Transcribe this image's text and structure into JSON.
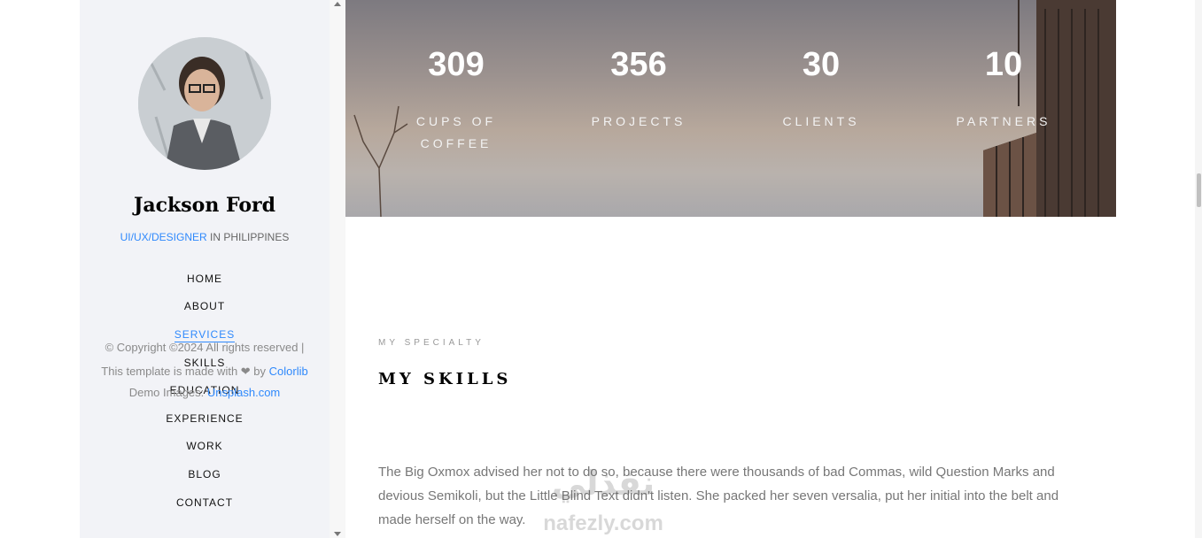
{
  "sidebar": {
    "name": "Jackson Ford",
    "role_link": "UI/UX/DESIGNER",
    "role_rest": " IN PHILIPPINES",
    "nav": [
      "HOME",
      "ABOUT",
      "SERVICES",
      "SKILLS",
      "EDUCATION",
      "EXPERIENCE",
      "WORK",
      "BLOG",
      "CONTACT"
    ],
    "active_nav": "SERVICES",
    "footer": {
      "copyright": "© Copyright ©2024 All rights reserved |",
      "made_with_prefix": "This template is made with ❤ by ",
      "made_with_link": "Colorlib",
      "demo_prefix": "Demo Images: ",
      "demo_link": "Unsplash.com"
    }
  },
  "stats": [
    {
      "number": "309",
      "label_line1": "CUPS OF",
      "label_line2": "COFFEE"
    },
    {
      "number": "356",
      "label_line1": "PROJECTS",
      "label_line2": ""
    },
    {
      "number": "30",
      "label_line1": "CLIENTS",
      "label_line2": ""
    },
    {
      "number": "10",
      "label_line1": "PARTNERS",
      "label_line2": ""
    }
  ],
  "section": {
    "subheading": "MY SPECIALTY",
    "heading": "MY SKILLS",
    "paragraph": "The Big Oxmox advised her not to do so, because there were thousands of bad Commas, wild Question Marks and devious Semikoli, but the Little Blind Text didn't listen. She packed her seven versalia, put her initial into the belt and made herself on the way."
  },
  "watermark": {
    "arabic": "نفذلي",
    "latin": "nafezly.com"
  },
  "colors": {
    "accent": "#2f89fc",
    "sidebar_bg": "#f2f3f7"
  }
}
